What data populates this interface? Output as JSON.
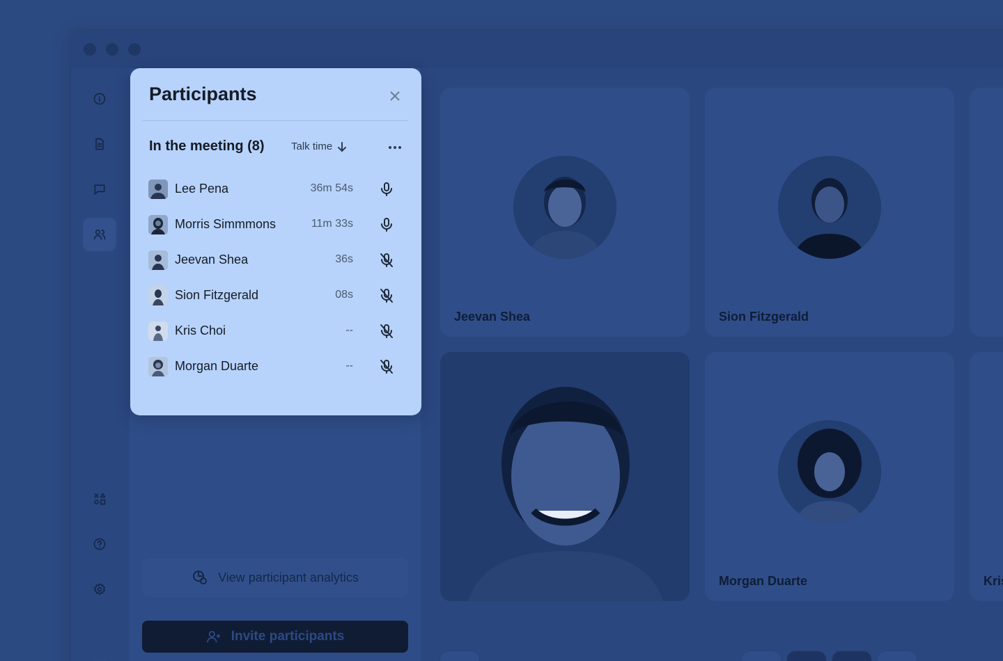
{
  "popover": {
    "title": "Participants",
    "section_title": "In the meeting (8)",
    "sort_label": "Talk time",
    "participants": [
      {
        "name": "Lee Pena",
        "time": "36m 54s",
        "mic": "on"
      },
      {
        "name": "Morris Simmmons",
        "time": "11m 33s",
        "mic": "on"
      },
      {
        "name": "Jeevan Shea",
        "time": "36s",
        "mic": "off"
      },
      {
        "name": "Sion Fitzgerald",
        "time": "08s",
        "mic": "off"
      },
      {
        "name": "Kris Choi",
        "time": "--",
        "mic": "off"
      },
      {
        "name": "Morgan Duarte",
        "time": "--",
        "mic": "off"
      }
    ]
  },
  "sidepanel": {
    "analytics_label": "View participant analytics",
    "invite_label": "Invite participants"
  },
  "tiles": {
    "t1": "Jeevan Shea",
    "t2": "Sion Fitzgerald",
    "t4": "Morgan Duarte",
    "t5": "Kris"
  },
  "icons": {
    "rail": [
      "info-icon",
      "document-icon",
      "chat-icon",
      "people-icon",
      "apps-icon",
      "help-icon",
      "gear-icon"
    ],
    "controls": [
      "add-person-icon",
      "screen-share-icon",
      "mic-off-icon",
      "video-off-icon",
      "emoji-icon"
    ]
  },
  "colors": {
    "overlay": "#2c4a82",
    "popover": "#b7d3fb",
    "invite": "#0f1c34"
  }
}
